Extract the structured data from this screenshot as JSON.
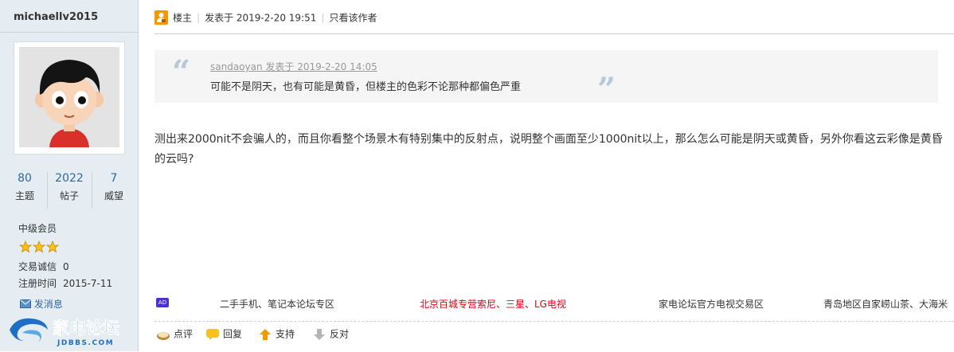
{
  "sidebar": {
    "username": "michaellv2015",
    "stats": [
      {
        "value": "80",
        "label": "主题"
      },
      {
        "value": "2022",
        "label": "帖子"
      },
      {
        "value": "7",
        "label": "威望"
      }
    ],
    "level": "中级会员",
    "stars": 3,
    "trade_label": "交易诚信",
    "trade_value": "0",
    "reg_label": "注册时间",
    "reg_value": "2015-7-11",
    "pm": "发消息",
    "logo_text": "家电论坛",
    "logo_domain": "JDBBS.COM"
  },
  "post": {
    "role": "楼主",
    "posted_at": "发表于 2019-2-20 19:51",
    "only_author": "只看该作者",
    "quote": {
      "header": "sandaoyan 发表于 2019-2-20 14:05",
      "text": "可能不是阴天，也有可能是黄昏，但楼主的色彩不论那种都偏色严重"
    },
    "body": "测出来2000nit不会骗人的，而且你看整个场景木有特别集中的反射点，说明整个画面至少1000nit以上，那么怎么可能是阴天或黄昏，另外你看这云彩像是黄昏的云吗?"
  },
  "ads": {
    "tag": "AD",
    "items": [
      {
        "text": "二手手机、笔记本论坛专区",
        "color": "#333333"
      },
      {
        "text": "北京百城专营索尼、三星、LG电视",
        "color": "#e60012"
      },
      {
        "text": "家电论坛官方电视交易区",
        "color": "#333333"
      },
      {
        "text": "青岛地区自家崂山茶、大海米",
        "color": "#333333"
      }
    ]
  },
  "actions": {
    "comment": "点评",
    "reply": "回复",
    "support": "支持",
    "oppose": "反对"
  },
  "colors": {
    "sidebar_bg": "#e5edf2",
    "link": "#336699",
    "badge": "#f39800"
  }
}
